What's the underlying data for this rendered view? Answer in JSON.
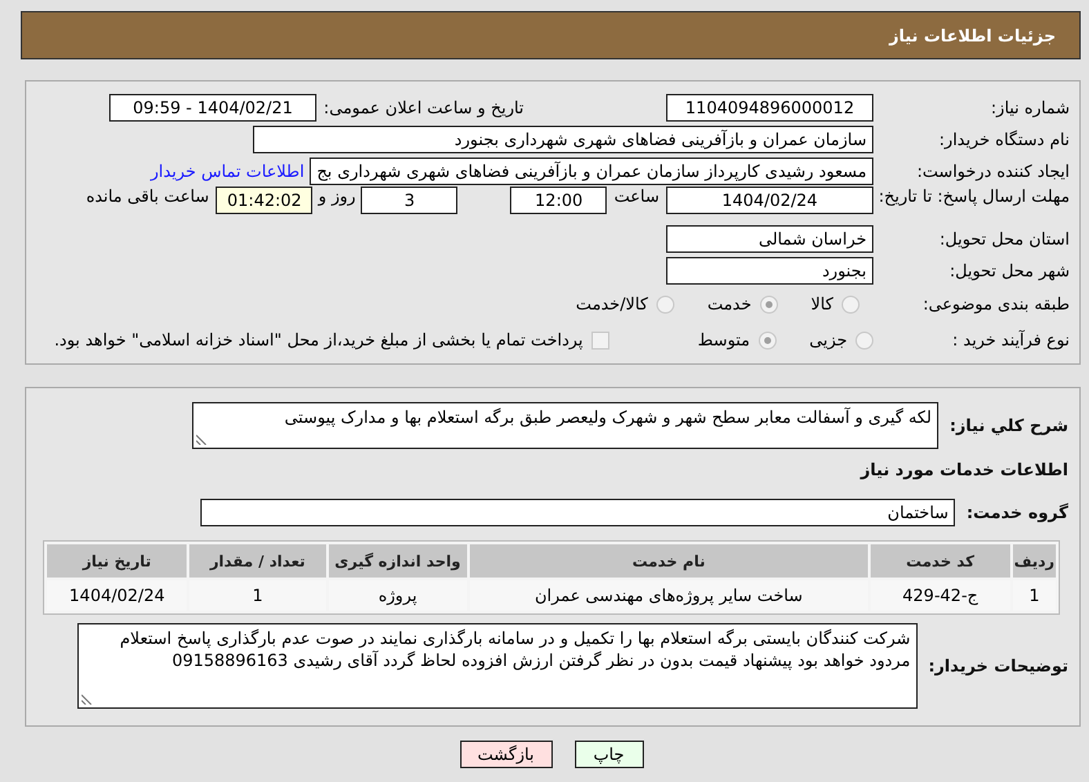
{
  "header": {
    "title": "جزئیات اطلاعات نیاز"
  },
  "need_number": {
    "label": "شماره نیاز:",
    "value": "1104094896000012"
  },
  "announce": {
    "label": "تاریخ و ساعت اعلان عمومی:",
    "value": "1404/02/21 - 09:59"
  },
  "buyer_org": {
    "label": "نام دستگاه خریدار:",
    "value": "سازمان عمران و بازآفرینی فضاهای شهری شهرداری بجنورد"
  },
  "requester": {
    "label": "ایجاد کننده درخواست:",
    "value": "مسعود رشیدی کارپرداز سازمان عمران و بازآفرینی فضاهای شهری شهرداری بج",
    "link": "اطلاعات تماس خریدار"
  },
  "deadline": {
    "label": "مهلت ارسال پاسخ: تا تاریخ:",
    "date": "1404/02/24",
    "time_label": "ساعت",
    "time": "12:00",
    "days": "3",
    "days_label": "روز و",
    "remaining": "01:42:02",
    "remaining_label": "ساعت باقی مانده"
  },
  "province": {
    "label": "استان محل تحویل:",
    "value": "خراسان شمالی"
  },
  "city": {
    "label": "شهر محل تحویل:",
    "value": "بجنورد"
  },
  "category": {
    "label": "طبقه بندی موضوعی:",
    "options": [
      {
        "label": "کالا",
        "selected": false
      },
      {
        "label": "خدمت",
        "selected": true
      },
      {
        "label": "کالا/خدمت",
        "selected": false
      }
    ]
  },
  "purchase_type": {
    "label": "نوع فرآیند خرید :",
    "options": [
      {
        "label": "جزیی",
        "selected": false
      },
      {
        "label": "متوسط",
        "selected": true
      }
    ],
    "payment_checkbox": {
      "label": "پرداخت تمام یا بخشی از مبلغ خرید،از محل \"اسناد خزانه اسلامی\" خواهد بود.",
      "checked": false
    }
  },
  "description": {
    "label": "شرح کلي نیاز:",
    "value": "لکه گیری و آسفالت معابر سطح شهر و شهرک ولیعصر طبق برگه استعلام بها و مدارک پیوستی"
  },
  "services_heading": "اطلاعات خدمات مورد نیاز",
  "service_group": {
    "label": "گروه خدمت:",
    "value": "ساختمان"
  },
  "table": {
    "columns": [
      "ردیف",
      "کد خدمت",
      "نام خدمت",
      "واحد اندازه گیری",
      "تعداد / مقدار",
      "تاریخ نیاز"
    ],
    "rows": [
      [
        "1",
        "ج-42-429",
        "ساخت سایر پروژه‌های مهندسی عمران",
        "پروژه",
        "1",
        "1404/02/24"
      ]
    ]
  },
  "buyer_notes": {
    "label": "توضیحات خریدار:",
    "value": "شرکت کنندگان بایستی برگه استعلام بها را تکمیل و در سامانه بارگذاری نمایند در صوت عدم بارگذاری پاسخ استعلام مردود خواهد بود پیشنهاد قیمت بدون در نظر گرفتن ارزش افزوده لحاظ گردد آقای رشیدی 09158896163"
  },
  "buttons": [
    {
      "label": "چاپ",
      "kind": "print"
    },
    {
      "label": "بازگشت",
      "kind": "back"
    }
  ]
}
